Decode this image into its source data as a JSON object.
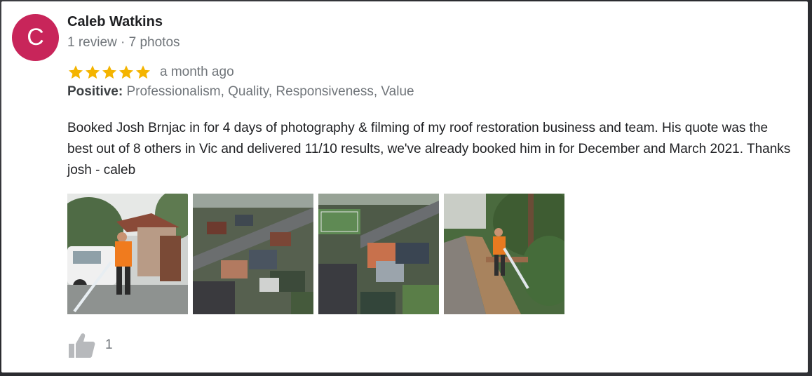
{
  "reviewer": {
    "initial": "C",
    "name": "Caleb Watkins",
    "meta": "1 review · 7 photos",
    "avatar_color": "#c8255a"
  },
  "rating": {
    "stars": 5,
    "time": "a month ago",
    "star_color": "#f4b400"
  },
  "positive": {
    "label": "Positive:",
    "values": "Professionalism, Quality, Responsiveness, Value"
  },
  "review_text": "Booked Josh Brnjac in for 4 days of photography & filming of my roof restoration business and team. His quote was the best out of 8 others in Vic and delivered 11/10 results, we've already booked him in for December and March 2021. Thanks josh - caleb",
  "photos": [
    {
      "icon": "pressure-washing-driveway-photo"
    },
    {
      "icon": "aerial-suburb-photo"
    },
    {
      "icon": "aerial-roof-photo"
    },
    {
      "icon": "pressure-washing-path-photo"
    }
  ],
  "like": {
    "icon": "thumbs-up-icon",
    "count": "1"
  }
}
